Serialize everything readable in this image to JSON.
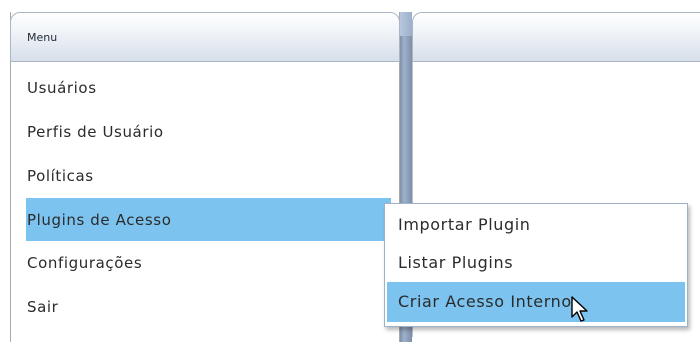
{
  "menu": {
    "title": "Menu",
    "items": [
      {
        "label": "Usuários"
      },
      {
        "label": "Perfis de Usuário"
      },
      {
        "label": "Políticas"
      },
      {
        "label": "Plugins de Acesso",
        "active": true
      },
      {
        "label": "Configurações"
      },
      {
        "label": "Sair"
      }
    ]
  },
  "submenu": {
    "items": [
      {
        "label": "Importar Plugin"
      },
      {
        "label": "Listar Plugins"
      },
      {
        "label": "Criar Acesso Interno",
        "hover": true
      }
    ]
  },
  "colors": {
    "highlight": "#7cc4ef",
    "header_border": "#a9b6c6",
    "splitter": "#8a9bb5"
  },
  "icons": {
    "cursor": "arrow-pointer-icon"
  }
}
